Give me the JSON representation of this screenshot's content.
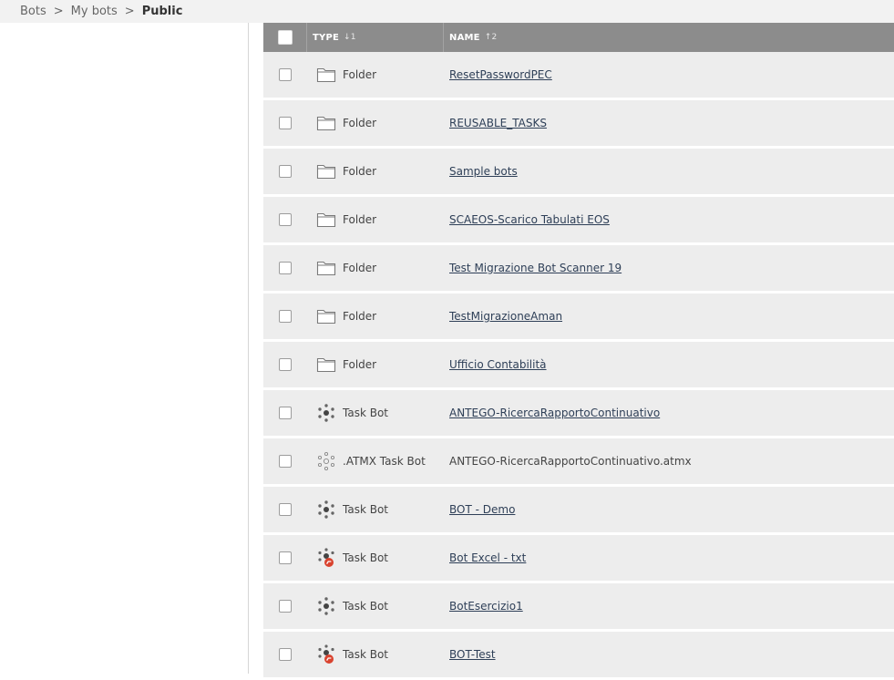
{
  "breadcrumb": {
    "items": [
      "Bots",
      "My bots",
      "Public"
    ],
    "separator": ">"
  },
  "table": {
    "columns": {
      "type": {
        "label": "TYPE",
        "sort": "↓1"
      },
      "name": {
        "label": "NAME",
        "sort": "↑2"
      }
    },
    "rows": [
      {
        "type": "Folder",
        "icon": "folder-icon",
        "name": "ResetPasswordPEC",
        "link": true
      },
      {
        "type": "Folder",
        "icon": "folder-icon",
        "name": "REUSABLE_TASKS",
        "link": true
      },
      {
        "type": "Folder",
        "icon": "folder-icon",
        "name": "Sample bots",
        "link": true
      },
      {
        "type": "Folder",
        "icon": "folder-icon",
        "name": "SCAEOS-Scarico Tabulati EOS",
        "link": true
      },
      {
        "type": "Folder",
        "icon": "folder-icon",
        "name": "Test Migrazione Bot Scanner 19",
        "link": true
      },
      {
        "type": "Folder",
        "icon": "folder-icon",
        "name": "TestMigrazioneAman",
        "link": true
      },
      {
        "type": "Folder",
        "icon": "folder-icon",
        "name": "Ufficio Contabilità",
        "link": true
      },
      {
        "type": "Task Bot",
        "icon": "task-bot-icon",
        "name": "ANTEGO-RicercaRapportoContinuativo",
        "link": true
      },
      {
        "type": ".ATMX Task Bot",
        "icon": "atmx-task-bot-icon",
        "name": "ANTEGO-RicercaRapportoContinuativo.atmx",
        "link": false
      },
      {
        "type": "Task Bot",
        "icon": "task-bot-icon",
        "name": "BOT - Demo",
        "link": true
      },
      {
        "type": "Task Bot",
        "icon": "task-bot-checked-out-icon",
        "name": "Bot Excel - txt",
        "link": true
      },
      {
        "type": "Task Bot",
        "icon": "task-bot-icon",
        "name": "BotEsercizio1",
        "link": true
      },
      {
        "type": "Task Bot",
        "icon": "task-bot-checked-out-icon",
        "name": "BOT-Test",
        "link": true
      }
    ]
  },
  "colors": {
    "header_bg": "#8c8c8c",
    "row_bg": "#ededed",
    "link": "#2e3f57",
    "checkout_badge": "#d9432f"
  }
}
